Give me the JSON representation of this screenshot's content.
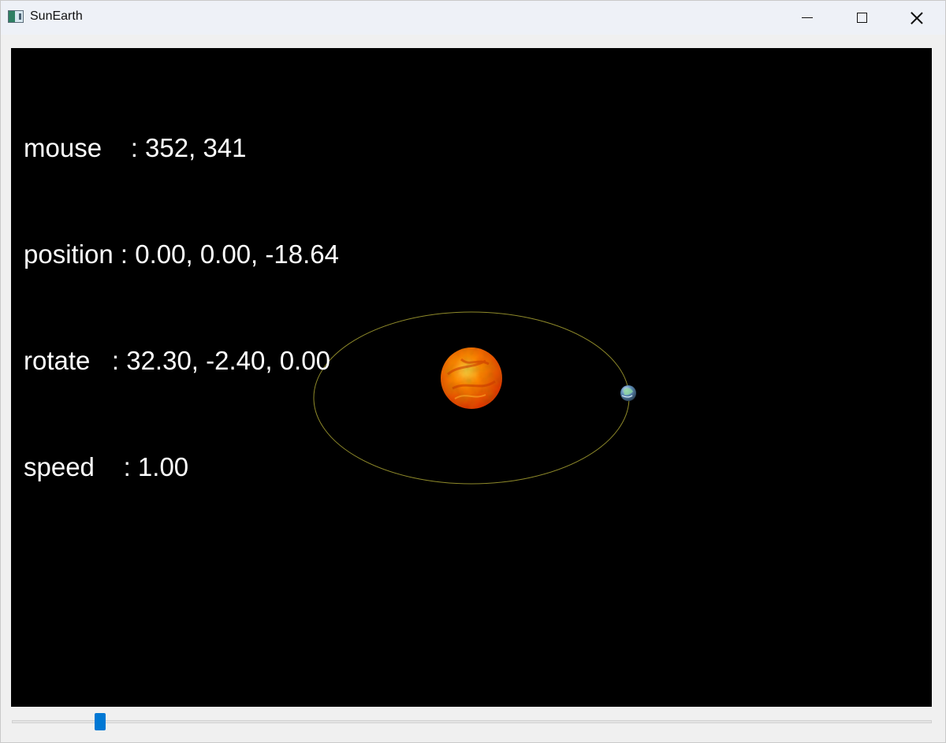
{
  "window": {
    "title": "SunEarth",
    "controls": {
      "minimize": "minimize-icon",
      "maximize": "maximize-icon",
      "close": "close-icon"
    }
  },
  "hud": {
    "mouse": "mouse    : 352, 341",
    "position": "position : 0.00, 0.00, -18.64",
    "rotate": "rotate   : 32.30, -2.40, 0.00",
    "speed": "speed    : 1.00"
  },
  "scene": {
    "background": "#000000",
    "orbit_color": "#8f8a2a",
    "sun_colors": [
      "#ffdf4a",
      "#ff8a00",
      "#d93200"
    ],
    "earth_colors": [
      "#e9f4ff",
      "#5f8eb8",
      "#2c4256"
    ]
  },
  "slider": {
    "value_fraction": 0.096,
    "accent": "#0078d4"
  }
}
